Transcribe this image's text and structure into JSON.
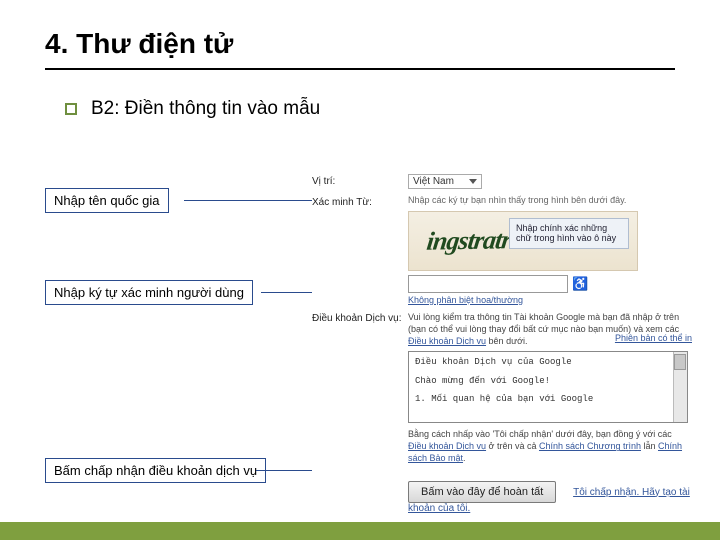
{
  "title": "4. Thư điện tử",
  "subtitle": "B2: Điền thông tin vào mẫu",
  "callouts": {
    "country": "Nhập tên quốc gia",
    "captcha": "Nhập ký tự xác minh người dùng",
    "accept": "Bấm chấp nhận điều khoản dịch vụ"
  },
  "form": {
    "location_label": "Vị trí:",
    "location_value": "Việt Nam",
    "captcha_label": "Xác minh Từ:",
    "captcha_hint": "Nhập các ký tự bạn nhìn thấy trong hình bên dưới đây.",
    "captcha_image_text": "ingstratr",
    "captcha_tooltip": "Nhập chính xác những chữ trong hình vào ô này",
    "captcha_sub": "Không phân biệt hoa/thường",
    "tos_label": "Điều khoản Dịch vụ:",
    "tos_intro_a": "Vui lòng kiểm tra thông tin Tài khoản Google mà bạn đã nhập ở trên (bạn có thể vui lòng thay đổi bất cứ mục nào bạn muốn) và xem các ",
    "tos_intro_link1": "Điều khoản Dịch vụ",
    "tos_intro_b": " bên dưới.",
    "tos_version": "Phiên bản có thể in",
    "tos_box_line1": "Điều khoản Dịch vụ của Google",
    "tos_box_line2": "Chào mừng đến với Google!",
    "tos_box_line3": "1. Mối quan hệ của bạn với Google",
    "agree_text_a": "Bằng cách nhấp vào 'Tôi chấp nhận' dưới đây, bạn đồng ý với các ",
    "agree_link1": "Điều khoản Dịch vụ",
    "agree_text_b": " ở trên và cả ",
    "agree_link2": "Chính sách Chương trình",
    "agree_text_c": " lẫn ",
    "agree_link3": "Chính sách Bảo mật",
    "agree_text_d": ".",
    "finish_button": "Bấm vào đây để hoàn tất",
    "cancel_link": "Tôi chấp nhận. Hãy tạo tài khoản của tôi."
  }
}
